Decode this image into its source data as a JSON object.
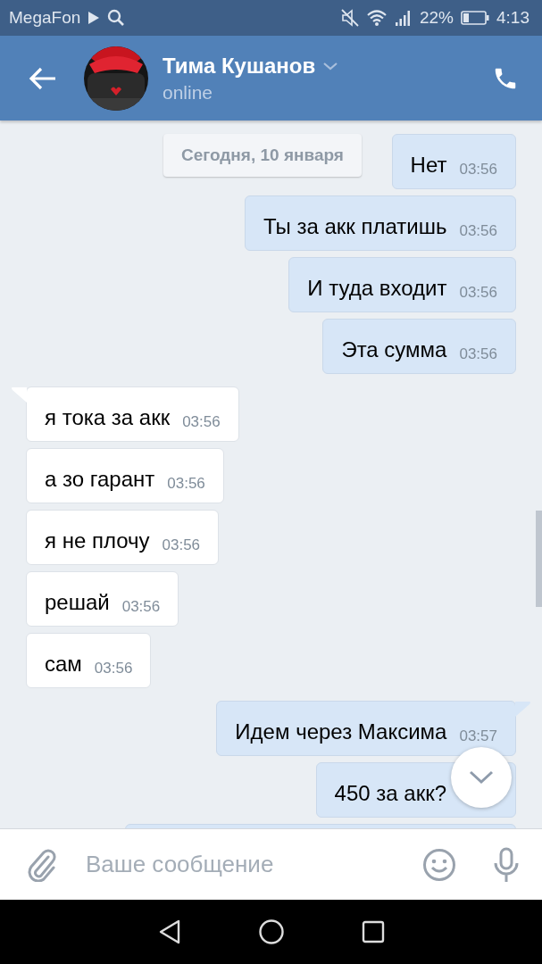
{
  "status_bar": {
    "carrier": "MegaFon",
    "battery": "22%",
    "time": "4:13"
  },
  "header": {
    "name": "Тима Кушанов",
    "status": "online"
  },
  "date_label": "Сегодня, 10 января",
  "messages": [
    {
      "kind": "outgoing",
      "text": "Нет",
      "time": "03:56"
    },
    {
      "kind": "outgoing",
      "text": "Ты за акк платишь",
      "time": "03:56"
    },
    {
      "kind": "outgoing",
      "text": "И туда входит",
      "time": "03:56"
    },
    {
      "kind": "outgoing",
      "text": "Эта сумма",
      "time": "03:56"
    },
    {
      "kind": "incoming",
      "text": "я тока за акк",
      "time": "03:56"
    },
    {
      "kind": "incoming",
      "text": "а зо гарант",
      "time": "03:56"
    },
    {
      "kind": "incoming",
      "text": "я не плочу",
      "time": "03:56"
    },
    {
      "kind": "incoming",
      "text": "решай",
      "time": "03:56"
    },
    {
      "kind": "incoming",
      "text": "сам",
      "time": "03:56"
    },
    {
      "kind": "outgoing",
      "text": "Идем через Максима",
      "time": "03:57"
    },
    {
      "kind": "outgoing",
      "text": "450 за акк?"
    }
  ],
  "composer": {
    "placeholder": "Ваше сообщение"
  }
}
